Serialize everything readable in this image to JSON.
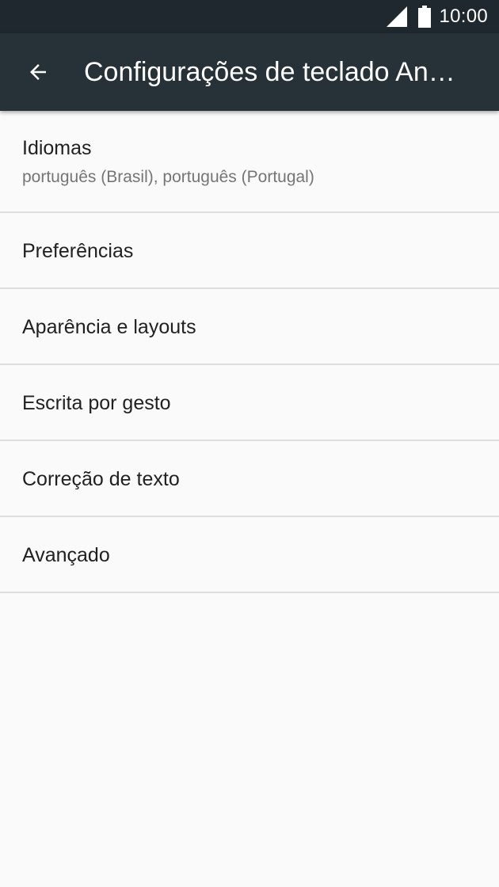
{
  "status_bar": {
    "time": "10:00",
    "icons": [
      "cell-signal-icon",
      "battery-icon"
    ]
  },
  "app_bar": {
    "back_icon": "arrow-back-icon",
    "title": "Configurações de teclado An…"
  },
  "colors": {
    "status_bar_bg": "#1f282e",
    "app_bar_bg": "#263238",
    "page_bg": "#fafafa",
    "divider": "#dedede",
    "primary_text": "#212121",
    "secondary_text": "#757575"
  },
  "settings": {
    "items": [
      {
        "label": "Idiomas",
        "summary": "português (Brasil), português (Portugal)"
      },
      {
        "label": "Preferências"
      },
      {
        "label": "Aparência e layouts"
      },
      {
        "label": "Escrita por gesto"
      },
      {
        "label": "Correção de texto"
      },
      {
        "label": "Avançado"
      }
    ]
  }
}
